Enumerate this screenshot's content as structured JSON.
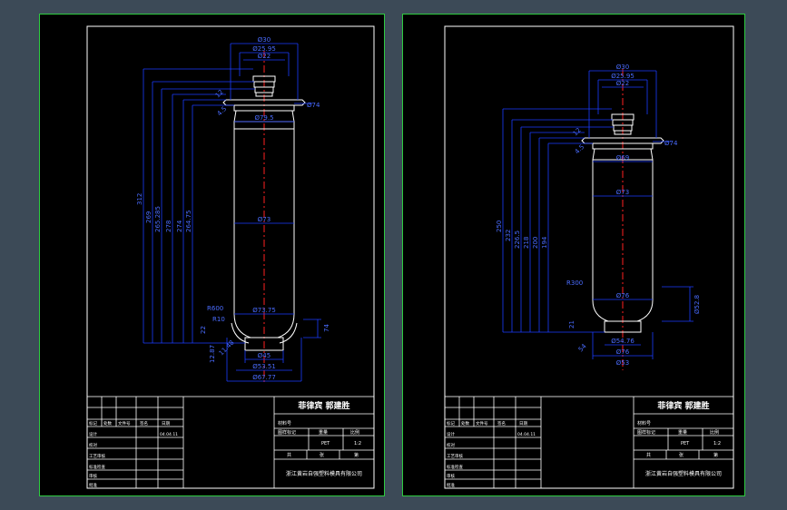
{
  "sheets": [
    {
      "dims": {
        "top_d1": "Ø30",
        "top_d2": "Ø25.95",
        "top_d3": "Ø22",
        "flange": "Ø74",
        "neck": "Ø79.5",
        "body": "Ø73",
        "bottom_r": "R600",
        "base_d": "Ø73.75",
        "r10": "R10",
        "side_74": "74",
        "foot_d1": "Ø45",
        "foot_d2": "Ø53.51",
        "foot_d3": "Ø67.77",
        "h_total": "312",
        "h1": "269",
        "h2": "265.285",
        "h3": "278",
        "h4": "274",
        "h5": "264.75",
        "small1": "12",
        "small2": "4.5",
        "small3": "22",
        "small4": "12.87",
        "small5": "11.48"
      },
      "title": {
        "designer_names": "菲律宾  郭建胜",
        "row_material": "材料号",
        "row_scale_header": "图样标记",
        "col_weight": "重量",
        "col_scale": "比例",
        "scale": "1:2",
        "material": "PET",
        "sheet_total": "共",
        "sheet_count": "张",
        "sheet_no": "第",
        "company": "浙江黄岩自强塑料模具有限公司",
        "left_header": [
          "标记",
          "处数",
          "文件号",
          "签名",
          "日期"
        ],
        "left_rows": [
          "设计",
          "校对",
          "工艺审核",
          "标准检查",
          "审核",
          "批准"
        ],
        "date": "04.04.11"
      }
    },
    {
      "dims": {
        "top_d1": "Ø30",
        "top_d2": "Ø25.95",
        "top_d3": "Ø22",
        "flange": "Ø74",
        "neck": "Ø69",
        "body": "Ø73",
        "bottom_r": "R300",
        "base_d": "Ø76",
        "side_d": "Ø52.8",
        "foot_d1": "Ø54.76",
        "foot_d2": "Ø76",
        "foot_d3": "Ø53",
        "h_total": "250",
        "h1": "232",
        "h2": "226.5",
        "h3": "218",
        "h4": "200",
        "h5": "194",
        "small1": "12",
        "small2": "4.5",
        "small3": "21",
        "small4": "54"
      },
      "title": {
        "designer_names": "菲律宾  郭建胜",
        "row_material": "材料号",
        "row_scale_header": "图样标记",
        "col_weight": "重量",
        "col_scale": "比例",
        "scale": "1:2",
        "material": "PET",
        "sheet_total": "共",
        "sheet_count": "张",
        "sheet_no": "第",
        "company": "浙江黄岩自强塑料模具有限公司",
        "left_header": [
          "标记",
          "处数",
          "文件号",
          "签名",
          "日期"
        ],
        "left_rows": [
          "设计",
          "校对",
          "工艺审核",
          "标准检查",
          "审核",
          "批准"
        ],
        "date": "04.04.11"
      }
    }
  ],
  "colors": {
    "background": "#3c4a57",
    "paper": "#000000",
    "border": "#2ecc40",
    "outline": "#ffffff",
    "dimension": "#1a3cff",
    "centerline": "#ff2020"
  }
}
